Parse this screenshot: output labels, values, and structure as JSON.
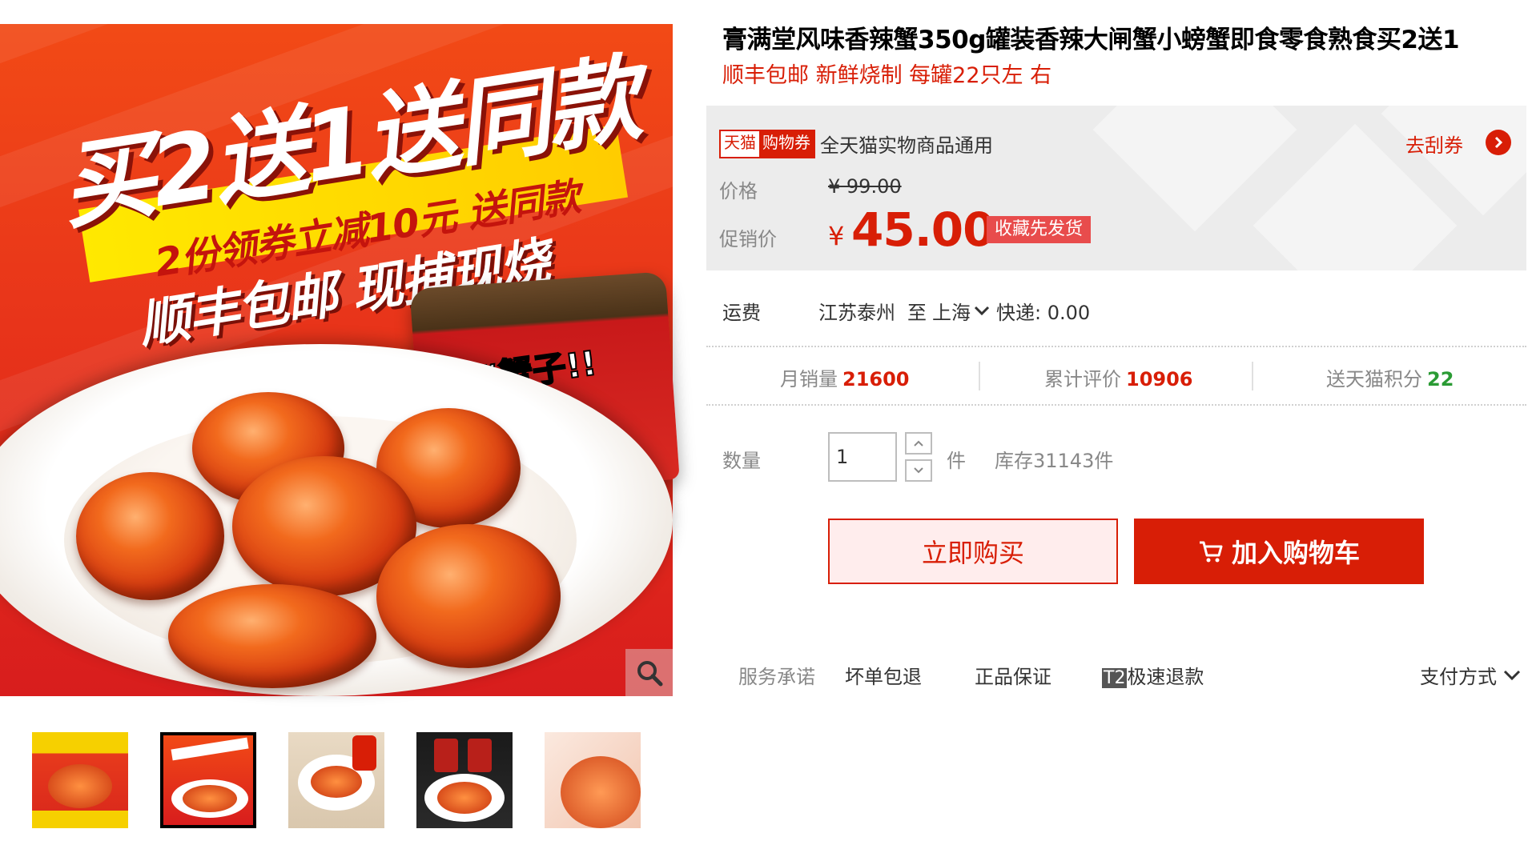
{
  "product": {
    "title": "膏满堂风味香辣蟹350g罐装香辣大闸蟹小螃蟹即食零食熟食买2送1",
    "subtitle": "顺丰包邮 新鲜烧制 每罐22只左 右"
  },
  "main_image": {
    "headline": "买2送1送同款",
    "band_text": "2份领券立减10元 送同款",
    "sub_headline": "顺丰包邮 现捕现烧",
    "jar_label": "“蟹子!!",
    "zoom_icon": "search-icon"
  },
  "thumbnails": [
    {
      "label": "thumbnail-1",
      "active": false
    },
    {
      "label": "thumbnail-2",
      "active": true
    },
    {
      "label": "thumbnail-3",
      "active": false
    },
    {
      "label": "thumbnail-4",
      "active": false
    },
    {
      "label": "thumbnail-5",
      "active": false
    }
  ],
  "coupon": {
    "badge_tmall": "天猫",
    "badge_coupon": "购物券",
    "text": "全天猫实物商品通用",
    "link": "去刮券"
  },
  "price": {
    "label": "价格",
    "original": "¥ 99.00",
    "promo_label": "促销价",
    "currency": "¥",
    "promo": "45.00",
    "promo_tag": "收藏先发货"
  },
  "shipping": {
    "label": "运费",
    "from": "江苏泰州",
    "to_word": "至",
    "to": "上海",
    "express": "快递: 0.00"
  },
  "stats": {
    "monthly_sales_label": "月销量",
    "monthly_sales": "21600",
    "reviews_label": "累计评价",
    "reviews": "10906",
    "points_label": "送天猫积分",
    "points": "22"
  },
  "quantity": {
    "label": "数量",
    "value": "1",
    "unit": "件",
    "stock": "库存31143件"
  },
  "actions": {
    "buy_now": "立即购买",
    "add_to_cart": "加入购物车"
  },
  "services": {
    "label": "服务承诺",
    "item1": "坏单包退",
    "item2": "正品保证",
    "item3_badge": "T2",
    "item3": "极速退款",
    "payment": "支付方式"
  },
  "colors": {
    "accent": "#d81e06",
    "panel_bg": "#ececec",
    "points_green": "#2a9b34"
  }
}
